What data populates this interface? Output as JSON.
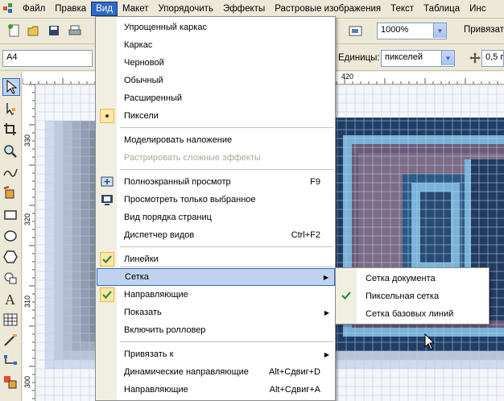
{
  "menubar": {
    "items": [
      "Файл",
      "Правка",
      "Вид",
      "Макет",
      "Упорядочить",
      "Эффекты",
      "Растровые изображения",
      "Текст",
      "Таблица",
      "Инс"
    ]
  },
  "toolbar": {
    "zoom_value": "1000%",
    "snap_label": "Привязать",
    "paper_value": "A4",
    "units_label": "Единицы:",
    "units_value": "пикселей",
    "nudge_value": "0,5 п"
  },
  "rulers": {
    "h_label": "420",
    "v_labels": [
      "330",
      "320",
      "310",
      "300"
    ]
  },
  "view_menu": {
    "items": [
      {
        "label": "Упрощенный каркас",
        "shortcut": "",
        "icon": "",
        "disabled": false
      },
      {
        "label": "Каркас",
        "shortcut": "",
        "icon": "",
        "disabled": false
      },
      {
        "label": "Черновой",
        "shortcut": "",
        "icon": "",
        "disabled": false
      },
      {
        "label": "Обычный",
        "shortcut": "",
        "icon": "",
        "disabled": false
      },
      {
        "label": "Расширенный",
        "shortcut": "",
        "icon": "",
        "disabled": false
      },
      {
        "label": "Пиксели",
        "shortcut": "",
        "icon": "radio-dot",
        "disabled": false
      },
      {
        "label": "Моделировать наложение",
        "shortcut": "",
        "icon": "",
        "disabled": false
      },
      {
        "label": "Растрировать сложные эффекты",
        "shortcut": "",
        "icon": "",
        "disabled": true
      },
      {
        "label": "Полноэкранный просмотр",
        "shortcut": "F9",
        "icon": "fullscreen-icon",
        "disabled": false
      },
      {
        "label": "Просмотреть только выбранное",
        "shortcut": "",
        "icon": "view-selected-icon",
        "disabled": false
      },
      {
        "label": "Вид порядка страниц",
        "shortcut": "",
        "icon": "",
        "disabled": false
      },
      {
        "label": "Диспетчер видов",
        "shortcut": "Ctrl+F2",
        "icon": "",
        "disabled": false
      },
      {
        "label": "Линейки",
        "shortcut": "",
        "icon": "check",
        "disabled": false
      },
      {
        "label": "Сетка",
        "shortcut": "",
        "icon": "",
        "disabled": false,
        "submenu": true
      },
      {
        "label": "Направляющие",
        "shortcut": "",
        "icon": "check",
        "disabled": false
      },
      {
        "label": "Показать",
        "shortcut": "",
        "icon": "",
        "disabled": false,
        "submenu": true
      },
      {
        "label": "Включить ролловер",
        "shortcut": "",
        "icon": "",
        "disabled": false
      },
      {
        "label": "Привязать к",
        "shortcut": "",
        "icon": "",
        "disabled": false,
        "submenu": true
      },
      {
        "label": "Динамические направляющие",
        "shortcut": "Alt+Сдвиг+D",
        "icon": "",
        "disabled": false
      },
      {
        "label": "Направляющие",
        "shortcut": "Alt+Сдвиг+A",
        "icon": "",
        "disabled": false
      }
    ]
  },
  "grid_submenu": {
    "items": [
      {
        "label": "Сетка документа",
        "icon": ""
      },
      {
        "label": "Пиксельная сетка",
        "icon": "check"
      },
      {
        "label": "Сетка базовых линий",
        "icon": ""
      }
    ]
  },
  "colors": {
    "accent": "#316ac5",
    "highlight": "#c1d2ee",
    "check": "#2e8b3e",
    "pixel_dark": "#1f3f66",
    "pixel_light": "#79b4d8",
    "pixel_mauve": "#6a5a78"
  }
}
